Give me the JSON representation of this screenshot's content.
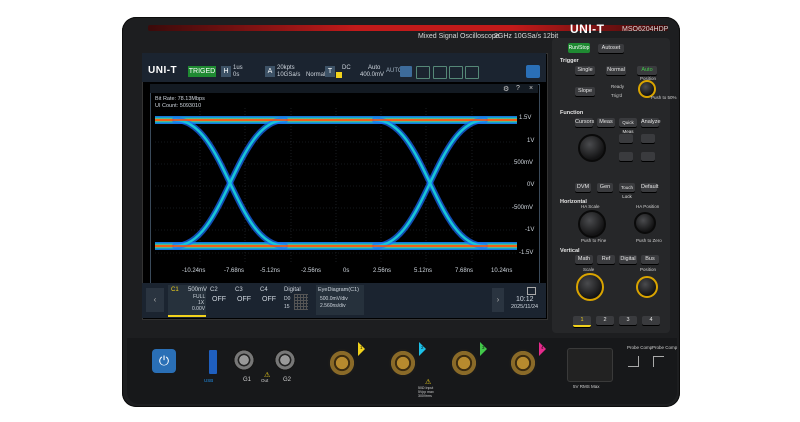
{
  "device": {
    "brand": "UNI-T",
    "model": "MSO6204HDP",
    "subtitle": "Mixed Signal Oscilloscope",
    "spec": "2GHz 10GSa/s 12bit"
  },
  "topbar": {
    "logo": "UNI-T",
    "status": "TRIGED",
    "h_label": "H",
    "h_val1": "1us",
    "h_val2": "0s",
    "a_label": "A",
    "a_val1": "20kpts",
    "a_val2": "10GSa/s",
    "a_mode": "Normal",
    "t_label": "T",
    "t_dc": "DC",
    "t_auto": "Auto",
    "t_level": "400.0mV",
    "t_auto2": "AUTO"
  },
  "window": {
    "line1": "Bit Rate: 78.13Mbps",
    "line2": "UI Count: 5093010",
    "yticks": [
      "1.5V",
      "1V",
      "500mV",
      "0V",
      "-500mV",
      "-1V",
      "-1.5V"
    ],
    "xticks": [
      "-10.24ns",
      "-7.68ns",
      "-5.12ns",
      "-2.56ns",
      "0s",
      "2.56ns",
      "5.12ns",
      "7.68ns",
      "10.24ns"
    ]
  },
  "channels": [
    {
      "name": "C1",
      "val": "500mV",
      "extra1": "FULL",
      "extra2": "1X",
      "extra3": "0.00V"
    },
    {
      "name": "C2",
      "val": "OFF"
    },
    {
      "name": "C3",
      "val": "OFF"
    },
    {
      "name": "C4",
      "val": "OFF"
    }
  ],
  "digital": {
    "label": "Digital",
    "d0": "D0",
    "d15": "15"
  },
  "eye": {
    "label": "EyeDiagram(C1)",
    "line1": "500.0mV/div",
    "line2": "2.560ns/div"
  },
  "clock": {
    "time": "10:12",
    "date": "2025/11/24"
  },
  "panel": {
    "trigger": "Trigger",
    "single": "Single",
    "normal": "Normal",
    "auto": "Auto",
    "slope": "Slope",
    "ready": "Ready",
    "trigd": "Trig'd",
    "position": "Position",
    "push50": "Push to 50%",
    "function": "Function",
    "cursors": "Cursors",
    "meas": "Meas",
    "quick_meas": "Quick Meas",
    "analyze": "Analyze",
    "dvm": "DVM",
    "gen": "Gen",
    "touch_lock": "Touch Lock",
    "default": "Default",
    "horizontal": "Horizontal",
    "h_scale": "HA Scale",
    "h_position": "HA Position",
    "push_fine": "Push to Fine",
    "push_zero": "Push to Zero",
    "vertical": "Vertical",
    "math": "Math",
    "ref": "Ref",
    "digital": "Digital",
    "bus": "Bus",
    "scale": "Scale",
    "v_position": "Position",
    "run_stop": "Run/Stop",
    "autoset": "Autoset",
    "ch_buttons": [
      "1",
      "2",
      "3",
      "4"
    ]
  },
  "front": {
    "g1": "G1",
    "out": "Out",
    "g2": "G2",
    "warn_text": "50Ω Input 5Vpp max 300Vrms",
    "rms": "5V RMS Max",
    "probe_comp1": "Probe Comp",
    "probe_comp2": "Probe Comp",
    "ch_numbers": [
      "1",
      "2",
      "3",
      "4"
    ]
  },
  "colors": {
    "ch1": "#f1d21c",
    "ch2": "#1cc0e8",
    "ch3": "#e62a8c",
    "ch4": "#42c84a",
    "accent": "#c21a1a"
  }
}
